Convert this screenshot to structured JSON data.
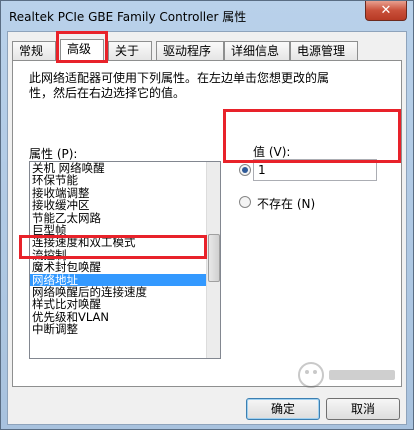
{
  "window": {
    "title": "Realtek PCIe GBE Family Controller 属性",
    "close_glyph": "✕"
  },
  "tabs": [
    {
      "label": "常规"
    },
    {
      "label": "高级"
    },
    {
      "label": "关于"
    },
    {
      "label": "驱动程序"
    },
    {
      "label": "详细信息"
    },
    {
      "label": "电源管理"
    }
  ],
  "active_tab": "高级",
  "description": "此网络适配器可使用下列属性。在左边单击您想更改的属性，然后在右边选择它的值。",
  "property": {
    "label": "属性 (P):",
    "items": [
      "关机 网络唤醒",
      "环保节能",
      "接收端调整",
      "接收缓冲区",
      "节能乙太网路",
      "巨型帧",
      "连接速度和双工模式",
      "流控制",
      "魔术封包唤醒",
      "网络地址",
      "网络唤醒后的连接速度",
      "样式比对唤醒",
      "优先级和VLAN",
      "中断调整"
    ],
    "selected": "网络地址"
  },
  "value": {
    "label": "值 (V):",
    "input_value": "1",
    "not_present_label": "不存在 (N)",
    "selected_option": "value"
  },
  "buttons": {
    "ok": "确定",
    "cancel": "取消"
  },
  "colors": {
    "highlight": "#e8222a",
    "selection": "#3399ff"
  }
}
